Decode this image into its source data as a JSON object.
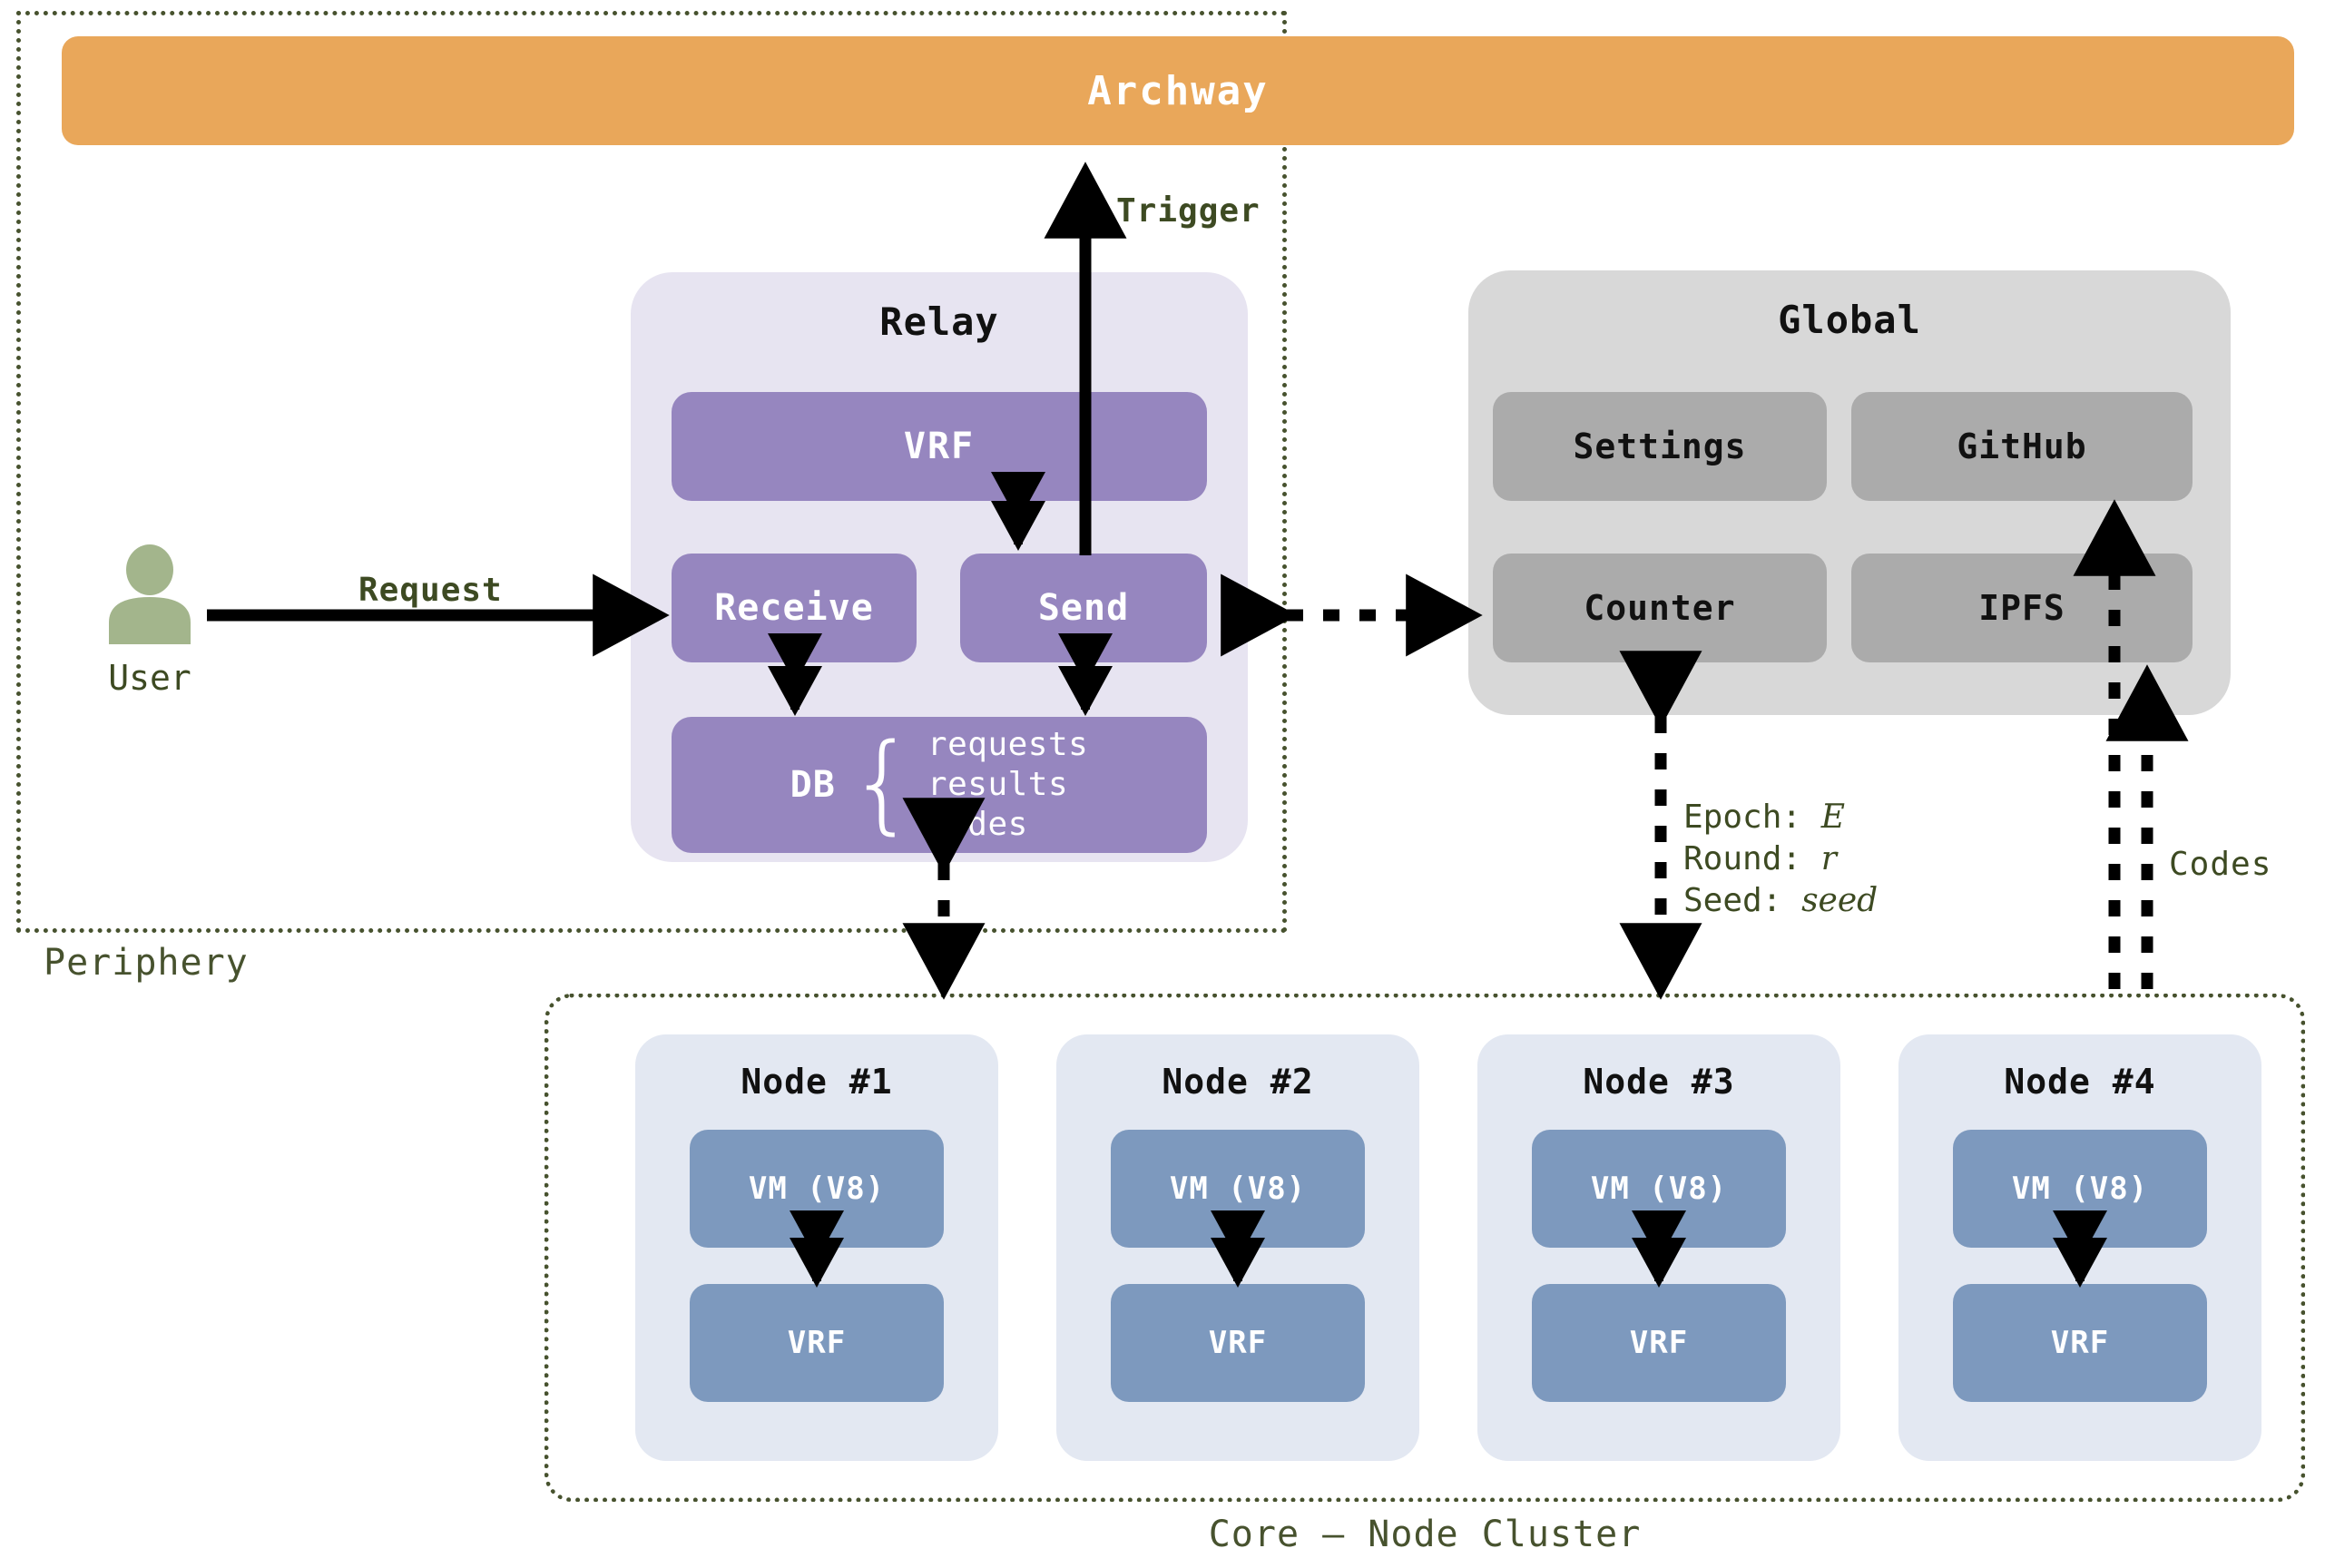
{
  "regions": {
    "periphery_label": "Periphery",
    "core_label": "Core — Node Cluster"
  },
  "archway": {
    "title": "Archway"
  },
  "relay": {
    "title": "Relay",
    "vrf": "VRF",
    "receive": "Receive",
    "send": "Send",
    "db": {
      "label": "DB",
      "items": [
        "requests",
        "results",
        "nodes"
      ]
    }
  },
  "global": {
    "title": "Global",
    "boxes": [
      {
        "label": "Settings"
      },
      {
        "label": "GitHub"
      },
      {
        "label": "Counter"
      },
      {
        "label": "IPFS"
      }
    ]
  },
  "nodes": [
    {
      "title": "Node #1",
      "vm": "VM (V8)",
      "vrf": "VRF"
    },
    {
      "title": "Node #2",
      "vm": "VM (V8)",
      "vrf": "VRF"
    },
    {
      "title": "Node #3",
      "vm": "VM (V8)",
      "vrf": "VRF"
    },
    {
      "title": "Node #4",
      "vm": "VM (V8)",
      "vrf": "VRF"
    }
  ],
  "actor": {
    "label": "User"
  },
  "edges": {
    "request": "Request",
    "trigger": "Trigger",
    "codes": "Codes",
    "params": {
      "epoch_key": "Epoch:",
      "epoch_value": "E",
      "round_key": "Round:",
      "round_value": "r",
      "seed_key": "Seed:",
      "seed_value": "seed"
    }
  },
  "colors": {
    "archway_orange": "#E9A75A",
    "relay_bg": "#E7E4F1",
    "relay_purple": "#9686BF",
    "global_bg": "#D8D8D8",
    "global_gray": "#ABABAB",
    "node_bg": "#E3E8F2",
    "node_blue": "#7D99BE",
    "dotted_border": "#47522E",
    "label_text": "#3D4A22",
    "user_green": "#A3B58C"
  }
}
